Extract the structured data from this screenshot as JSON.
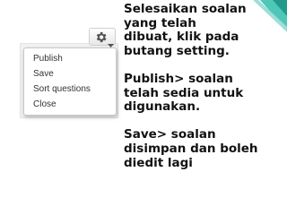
{
  "menu": {
    "items": [
      "Publish",
      "Save",
      "Sort questions",
      "Close"
    ]
  },
  "icons": {
    "settings": "gear-icon",
    "dropdown": "caret-down-icon"
  },
  "instructions": {
    "paragraphs": [
      [
        "Selesaikan soalan",
        "yang telah",
        "dibuat, klik pada",
        "butang setting."
      ],
      [
        "Publish> soalan",
        "telah sedia untuk",
        "digunakan."
      ],
      [
        "Save> soalan",
        "disimpan dan boleh",
        "diedit lagi"
      ]
    ]
  },
  "colors": {
    "accent": "#2bb3a3",
    "menu_border": "#c9c9c9",
    "text": "#111111"
  }
}
